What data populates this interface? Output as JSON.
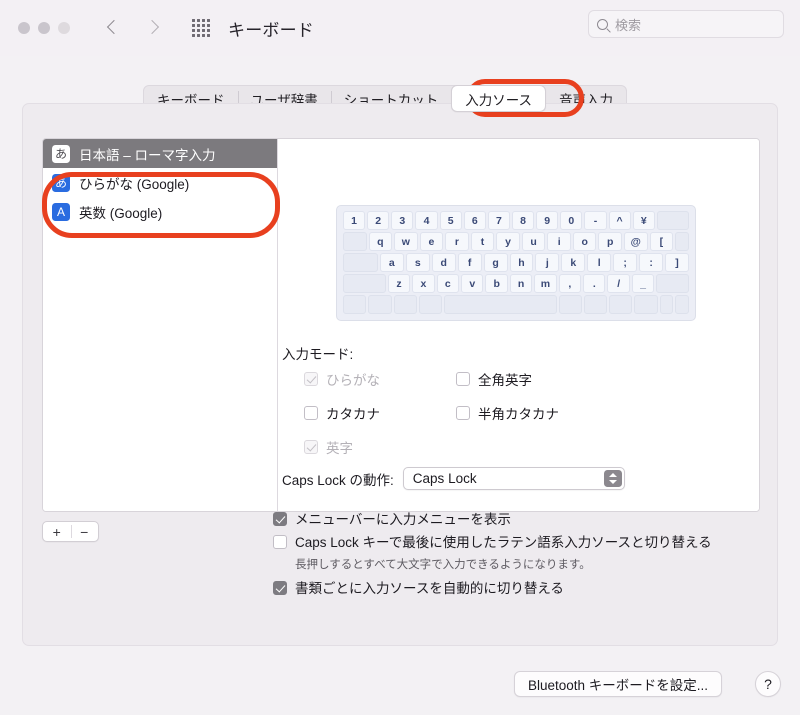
{
  "window": {
    "title": "キーボード",
    "traffic_lights": [
      "close",
      "minimize",
      "zoom"
    ],
    "back_icon": "chevron-left-icon",
    "forward_icon": "chevron-right-icon",
    "grid_icon": "grid-icon"
  },
  "search": {
    "placeholder": "検索",
    "value": "",
    "icon": "search-icon"
  },
  "tabs": [
    {
      "label": "キーボード",
      "selected": false
    },
    {
      "label": "ユーザ辞書",
      "selected": false
    },
    {
      "label": "ショートカット",
      "selected": false
    },
    {
      "label": "入力ソース",
      "selected": true
    },
    {
      "label": "音声入力",
      "selected": false
    }
  ],
  "input_sources": [
    {
      "badge": "あ",
      "badge_style": "white",
      "label": "日本語 – ローマ字入力",
      "selected": true
    },
    {
      "badge": "あ",
      "badge_style": "blue",
      "label": "ひらがな (Google)",
      "selected": false
    },
    {
      "badge": "A",
      "badge_style": "blue",
      "label": "英数 (Google)",
      "selected": false
    }
  ],
  "list_controls": {
    "add_label": "+",
    "remove_label": "−"
  },
  "keyboard_preview": {
    "rows": [
      [
        "1",
        "2",
        "3",
        "4",
        "5",
        "6",
        "7",
        "8",
        "9",
        "0",
        "-",
        "^",
        "¥",
        ""
      ],
      [
        "",
        "q",
        "w",
        "e",
        "r",
        "t",
        "y",
        "u",
        "i",
        "o",
        "p",
        "@",
        "[",
        ""
      ],
      [
        "",
        "a",
        "s",
        "d",
        "f",
        "g",
        "h",
        "j",
        "k",
        "l",
        ";",
        ":",
        "]",
        ""
      ],
      [
        "",
        "",
        "z",
        "x",
        "c",
        "v",
        "b",
        "n",
        "m",
        ",",
        ".",
        "/",
        "_",
        ""
      ],
      [
        "",
        "",
        "",
        "",
        "",
        "",
        "",
        "",
        "",
        "",
        "",
        ""
      ]
    ]
  },
  "input_mode": {
    "title": "入力モード:",
    "options": [
      {
        "label": "ひらがな",
        "checked": true,
        "disabled": true
      },
      {
        "label": "全角英字",
        "checked": false,
        "disabled": false
      },
      {
        "label": "カタカナ",
        "checked": false,
        "disabled": false
      },
      {
        "label": "半角カタカナ",
        "checked": false,
        "disabled": false
      },
      {
        "label": "英字",
        "checked": true,
        "disabled": true
      },
      {
        "label": "",
        "checked": false,
        "disabled": false
      }
    ]
  },
  "caps_lock": {
    "label": "Caps Lock の動作:",
    "value": "Caps Lock",
    "stepper_icon": "chevron-up-down-icon"
  },
  "options": [
    {
      "label": "メニューバーに入力メニューを表示",
      "checked": true,
      "sub": ""
    },
    {
      "label": "Caps Lock キーで最後に使用したラテン語系入力ソースと切り替える",
      "checked": false,
      "sub": "長押しするとすべて大文字で入力できるようになります。"
    },
    {
      "label": "書類ごとに入力ソースを自動的に切り替える",
      "checked": true,
      "sub": ""
    }
  ],
  "footer": {
    "bluetooth_label": "Bluetooth キーボードを設定...",
    "help_label": "?"
  },
  "annotations": {
    "color": "#e8401f",
    "shapes": [
      "tab-highlight-ellipse",
      "input-source-highlight-ellipse"
    ]
  }
}
